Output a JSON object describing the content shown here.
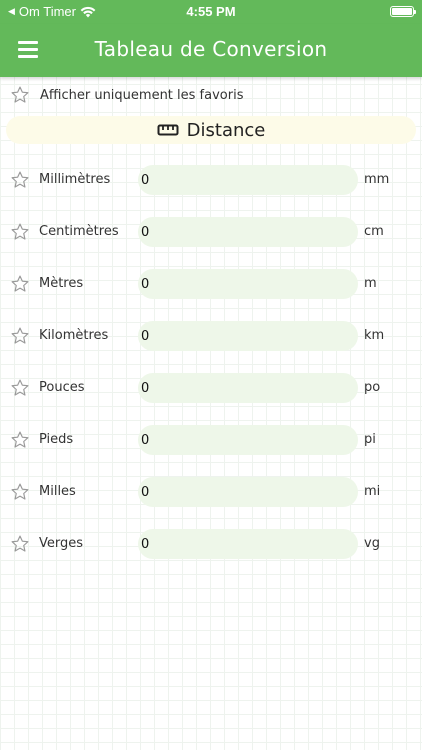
{
  "status_bar": {
    "back_glyph": "◀",
    "carrier": "Om Timer",
    "time": "4:55 PM"
  },
  "nav": {
    "title": "Tableau de Conversion",
    "menu_icon": "hamburger-icon"
  },
  "favorites_toggle": {
    "label": "Afficher uniquement les favoris",
    "icon": "star-outline-icon"
  },
  "section": {
    "title": "Distance",
    "icon": "ruler-icon"
  },
  "units": [
    {
      "name": "Millimètres",
      "value": "0",
      "abbr": "mm"
    },
    {
      "name": "Centimètres",
      "value": "0",
      "abbr": "cm"
    },
    {
      "name": "Mètres",
      "value": "0",
      "abbr": "m"
    },
    {
      "name": "Kilomètres",
      "value": "0",
      "abbr": "km"
    },
    {
      "name": "Pouces",
      "value": "0",
      "abbr": "po"
    },
    {
      "name": "Pieds",
      "value": "0",
      "abbr": "pi"
    },
    {
      "name": "Milles",
      "value": "0",
      "abbr": "mi"
    },
    {
      "name": "Verges",
      "value": "0",
      "abbr": "vg"
    }
  ],
  "colors": {
    "header_green": "#63b95a",
    "input_bg": "#eef7e9",
    "section_bg": "#fdfbe8",
    "star_outline": "#9a9a9a"
  }
}
